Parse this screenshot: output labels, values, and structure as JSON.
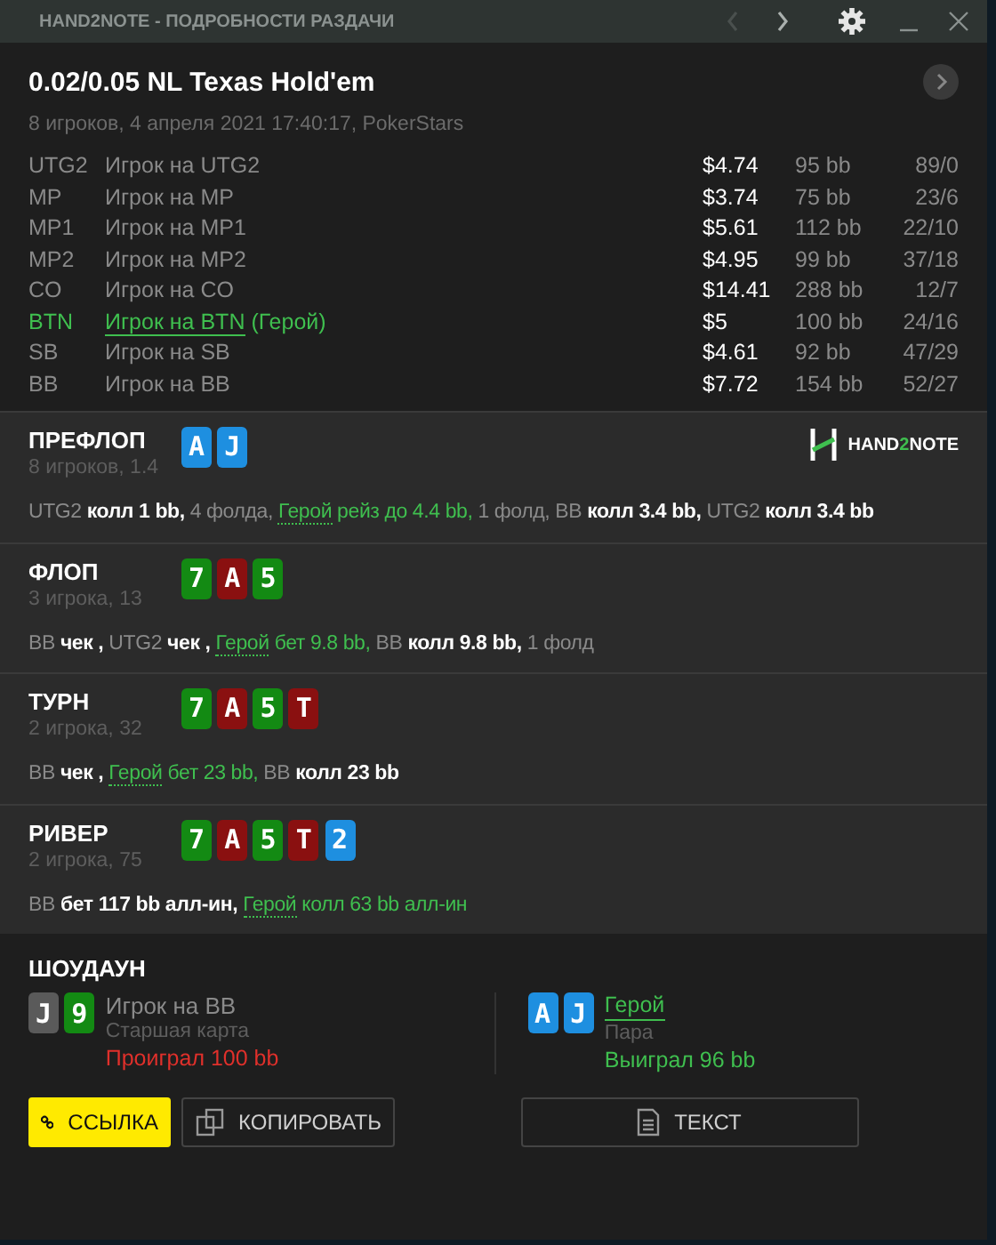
{
  "window": {
    "title": "HAND2NOTE - ПОДРОБНОСТИ РАЗДАЧИ",
    "nav": [
      {
        "kind": "back",
        "disabled": true
      },
      {
        "kind": "forward",
        "disabled": false
      }
    ]
  },
  "hand": {
    "title": "0.02/0.05 NL Texas Hold'em",
    "subtitle": "8 игроков, 4 апреля 2021 17:40:17, PokerStars"
  },
  "players": [
    {
      "position": "UTG2",
      "name": "Игрок на UTG2",
      "stack": "$4.74",
      "bb": "95 bb",
      "stats": "89/0",
      "hero": false
    },
    {
      "position": "MP",
      "name": "Игрок на MP",
      "stack": "$3.74",
      "bb": "75 bb",
      "stats": "23/6",
      "hero": false
    },
    {
      "position": "MP1",
      "name": "Игрок на MP1",
      "stack": "$5.61",
      "bb": "112 bb",
      "stats": "22/10",
      "hero": false
    },
    {
      "position": "MP2",
      "name": "Игрок на MP2",
      "stack": "$4.95",
      "bb": "99 bb",
      "stats": "37/18",
      "hero": false
    },
    {
      "position": "CO",
      "name": "Игрок на CO",
      "stack": "$14.41",
      "bb": "288 bb",
      "stats": "12/7",
      "hero": false
    },
    {
      "position": "BTN",
      "name": "Игрок на BTN",
      "note": "(Герой)",
      "stack": "$5",
      "bb": "100 bb",
      "stats": "24/16",
      "hero": true
    },
    {
      "position": "SB",
      "name": "Игрок на SB",
      "stack": "$4.61",
      "bb": "92 bb",
      "stats": "47/29",
      "hero": false
    },
    {
      "position": "BB",
      "name": "Игрок на BB",
      "stack": "$7.72",
      "bb": "154 bb",
      "stats": "52/27",
      "hero": false
    }
  ],
  "streets": [
    {
      "name": "ПРЕФЛОП",
      "info": "8 игроков, 1.4",
      "logo": {
        "before": "HAND",
        "accent": "2",
        "after": "NOTE"
      },
      "cards": [
        {
          "rank": "A",
          "color": "#1e8fe0"
        },
        {
          "rank": "J",
          "color": "#1e8fe0"
        }
      ],
      "actions": [
        {
          "kind": "player",
          "text": "UTG2"
        },
        {
          "kind": "action",
          "text": "колл 1 bb,"
        },
        {
          "kind": "info",
          "text": "4 фолда,"
        },
        {
          "kind": "hero",
          "text": "Герой"
        },
        {
          "kind": "hero-action",
          "text": "рейз до 4.4 bb,"
        },
        {
          "kind": "info",
          "text": "1 фолд,"
        },
        {
          "kind": "player",
          "text": "BB"
        },
        {
          "kind": "action",
          "text": "колл 3.4 bb,"
        },
        {
          "kind": "player",
          "text": "UTG2"
        },
        {
          "kind": "action",
          "text": "колл 3.4 bb"
        }
      ]
    },
    {
      "name": "ФЛОП",
      "info": "3 игрока, 13",
      "cards": [
        {
          "rank": "7",
          "color": "#138a13"
        },
        {
          "rank": "A",
          "color": "#8a1010"
        },
        {
          "rank": "5",
          "color": "#138a13"
        }
      ],
      "actions": [
        {
          "kind": "player",
          "text": "BB"
        },
        {
          "kind": "action",
          "text": "чек ,"
        },
        {
          "kind": "player",
          "text": "UTG2"
        },
        {
          "kind": "action",
          "text": "чек ,"
        },
        {
          "kind": "hero",
          "text": "Герой"
        },
        {
          "kind": "hero-action",
          "text": "бет 9.8 bb,"
        },
        {
          "kind": "player",
          "text": "BB"
        },
        {
          "kind": "action",
          "text": "колл 9.8 bb,"
        },
        {
          "kind": "info",
          "text": "1 фолд"
        }
      ]
    },
    {
      "name": "ТУРН",
      "info": "2 игрока, 32",
      "cards": [
        {
          "rank": "7",
          "color": "#138a13"
        },
        {
          "rank": "A",
          "color": "#8a1010"
        },
        {
          "rank": "5",
          "color": "#138a13"
        },
        {
          "rank": "T",
          "color": "#8a1010"
        }
      ],
      "actions": [
        {
          "kind": "player",
          "text": "BB"
        },
        {
          "kind": "action",
          "text": "чек ,"
        },
        {
          "kind": "hero",
          "text": "Герой"
        },
        {
          "kind": "hero-action",
          "text": "бет 23 bb,"
        },
        {
          "kind": "player",
          "text": "BB"
        },
        {
          "kind": "action",
          "text": "колл 23 bb"
        }
      ]
    },
    {
      "name": "РИВЕР",
      "info": "2 игрока, 75",
      "cards": [
        {
          "rank": "7",
          "color": "#138a13"
        },
        {
          "rank": "A",
          "color": "#8a1010"
        },
        {
          "rank": "5",
          "color": "#138a13"
        },
        {
          "rank": "T",
          "color": "#8a1010"
        },
        {
          "rank": "2",
          "color": "#1e8fe0"
        }
      ],
      "actions": [
        {
          "kind": "player",
          "text": "BB"
        },
        {
          "kind": "action",
          "text": "бет 117 bb алл-ин,"
        },
        {
          "kind": "hero",
          "text": "Герой"
        },
        {
          "kind": "hero-action",
          "text": "колл 63 bb алл-ин"
        }
      ]
    }
  ],
  "showdown": {
    "title": "ШОУДАУН",
    "hands": [
      {
        "name": "Игрок на BB",
        "hero": false,
        "combo": "Старшая карта",
        "result": "Проиграл 100 bb",
        "won": false,
        "cards": [
          {
            "rank": "J",
            "color": "#5a5a5a"
          },
          {
            "rank": "9",
            "color": "#138a13"
          }
        ]
      },
      {
        "name": "Герой",
        "hero": true,
        "combo": "Пара",
        "result": "Выиграл 96 bb",
        "won": true,
        "cards": [
          {
            "rank": "A",
            "color": "#1e8fe0"
          },
          {
            "rank": "J",
            "color": "#1e8fe0"
          }
        ]
      }
    ]
  },
  "buttons": [
    {
      "label": "ССЫЛКА",
      "kind": "link"
    },
    {
      "label": "КОПИРОВАТЬ",
      "kind": "copy"
    },
    {
      "label": "ТЕКСТ",
      "kind": "text"
    }
  ]
}
